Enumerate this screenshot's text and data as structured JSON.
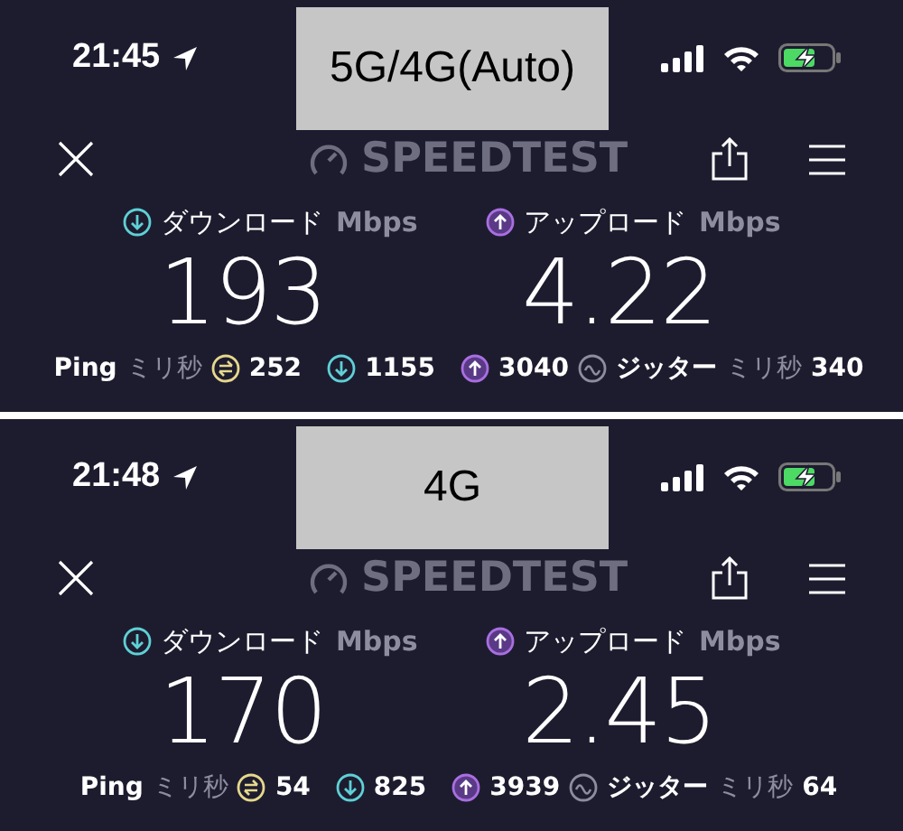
{
  "panels": [
    {
      "overlay_label": "5G/4G(Auto)",
      "time": "21:45",
      "app_title": "SPEEDTEST",
      "download": {
        "label": "ダウンロード",
        "unit": "Mbps",
        "value": "193"
      },
      "upload": {
        "label": "アップロード",
        "unit": "Mbps",
        "value": "4.22"
      },
      "ping": {
        "label": "Ping",
        "unit": "ミリ秒",
        "idle": "252",
        "download": "1155",
        "upload": "3040"
      },
      "jitter": {
        "label": "ジッター",
        "unit": "ミリ秒",
        "value": "340"
      }
    },
    {
      "overlay_label": "4G",
      "time": "21:48",
      "app_title": "SPEEDTEST",
      "download": {
        "label": "ダウンロード",
        "unit": "Mbps",
        "value": "170"
      },
      "upload": {
        "label": "アップロード",
        "unit": "Mbps",
        "value": "2.45"
      },
      "ping": {
        "label": "Ping",
        "unit": "ミリ秒",
        "idle": "54",
        "download": "825",
        "upload": "3939"
      },
      "jitter": {
        "label": "ジッター",
        "unit": "ミリ秒",
        "value": "64"
      }
    }
  ]
}
